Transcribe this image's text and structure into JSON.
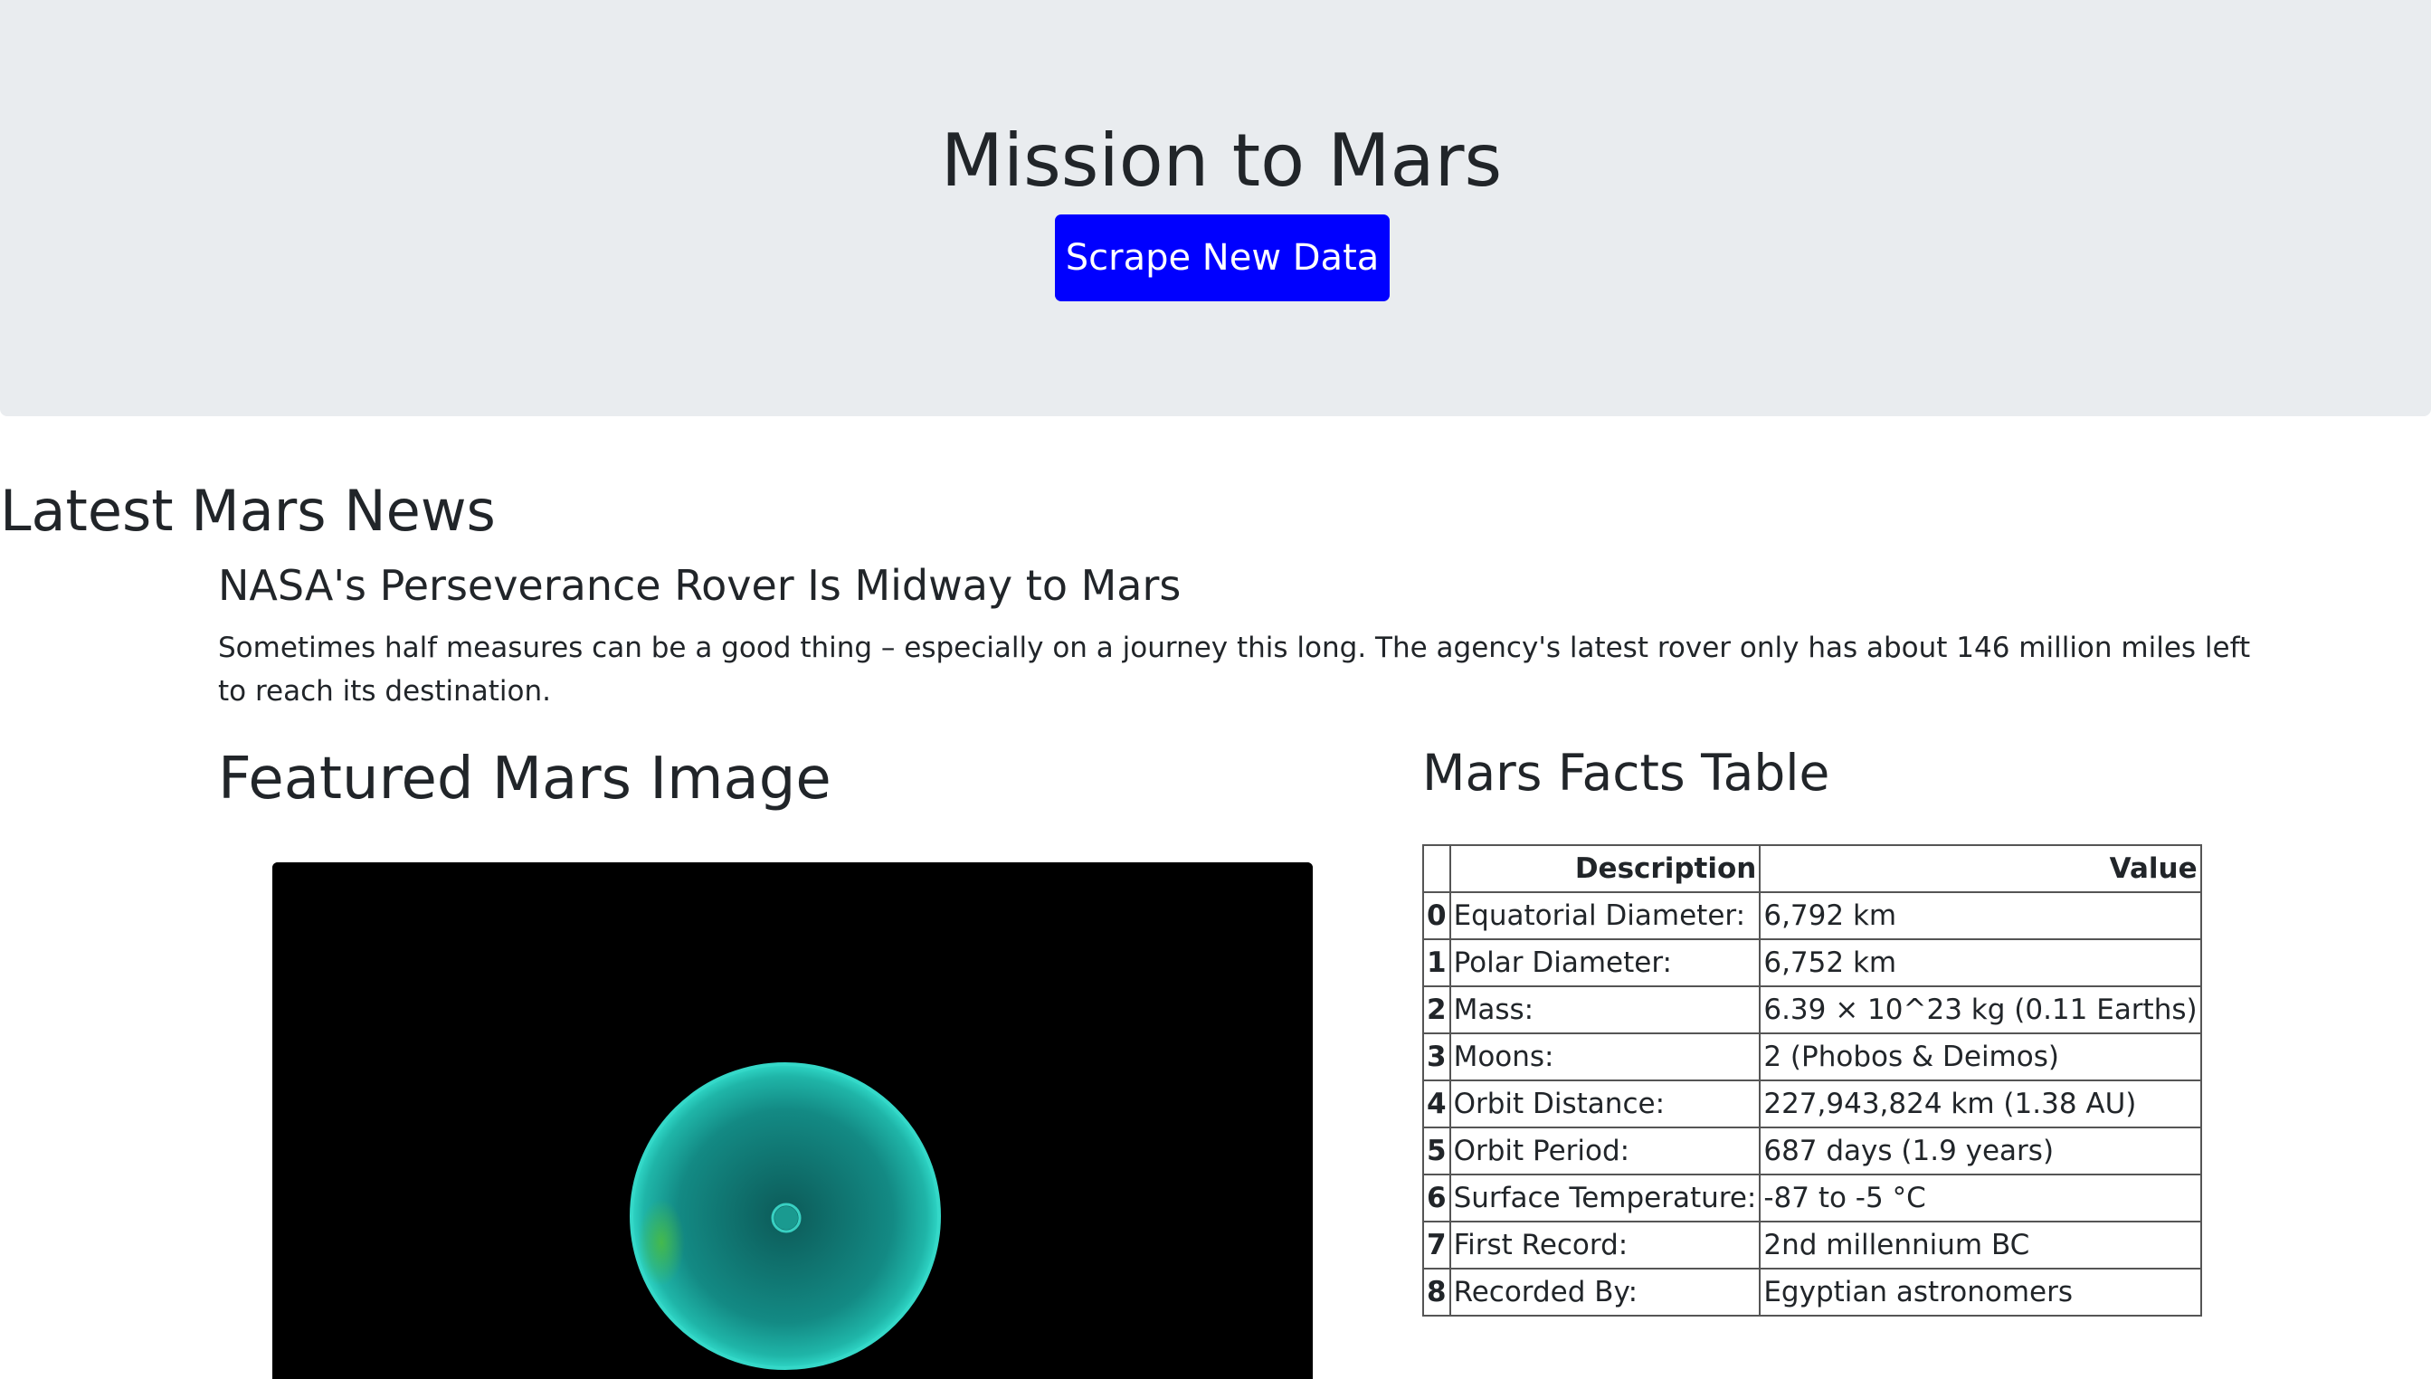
{
  "header": {
    "title": "Mission to Mars",
    "button_label": "Scrape New Data"
  },
  "news": {
    "section_title": "Latest Mars News",
    "headline": "NASA's Perseverance Rover Is Midway to Mars",
    "teaser": "Sometimes half measures can be a good thing – especially on a journey this long. The agency's latest rover only has about 146 million miles left to reach its destination."
  },
  "featured": {
    "section_title": "Featured Mars Image"
  },
  "facts": {
    "section_title": "Mars Facts Table",
    "columns": [
      "",
      "Description",
      "Value"
    ],
    "rows": [
      {
        "index": "0",
        "description": "Equatorial Diameter:",
        "value": "6,792 km"
      },
      {
        "index": "1",
        "description": "Polar Diameter:",
        "value": "6,752 km"
      },
      {
        "index": "2",
        "description": "Mass:",
        "value": "6.39 × 10^23 kg (0.11 Earths)"
      },
      {
        "index": "3",
        "description": "Moons:",
        "value": "2 (Phobos & Deimos)"
      },
      {
        "index": "4",
        "description": "Orbit Distance:",
        "value": "227,943,824 km (1.38 AU)"
      },
      {
        "index": "5",
        "description": "Orbit Period:",
        "value": "687 days (1.9 years)"
      },
      {
        "index": "6",
        "description": "Surface Temperature:",
        "value": "-87 to -5 °C"
      },
      {
        "index": "7",
        "description": "First Record:",
        "value": "2nd millennium BC"
      },
      {
        "index": "8",
        "description": "Recorded By:",
        "value": "Egyptian astronomers"
      }
    ]
  },
  "colors": {
    "jumbotron_bg": "#e9ecef",
    "button_bg": "#0000ff",
    "image_bg": "#000000",
    "sphere": "#1fb5a8"
  }
}
